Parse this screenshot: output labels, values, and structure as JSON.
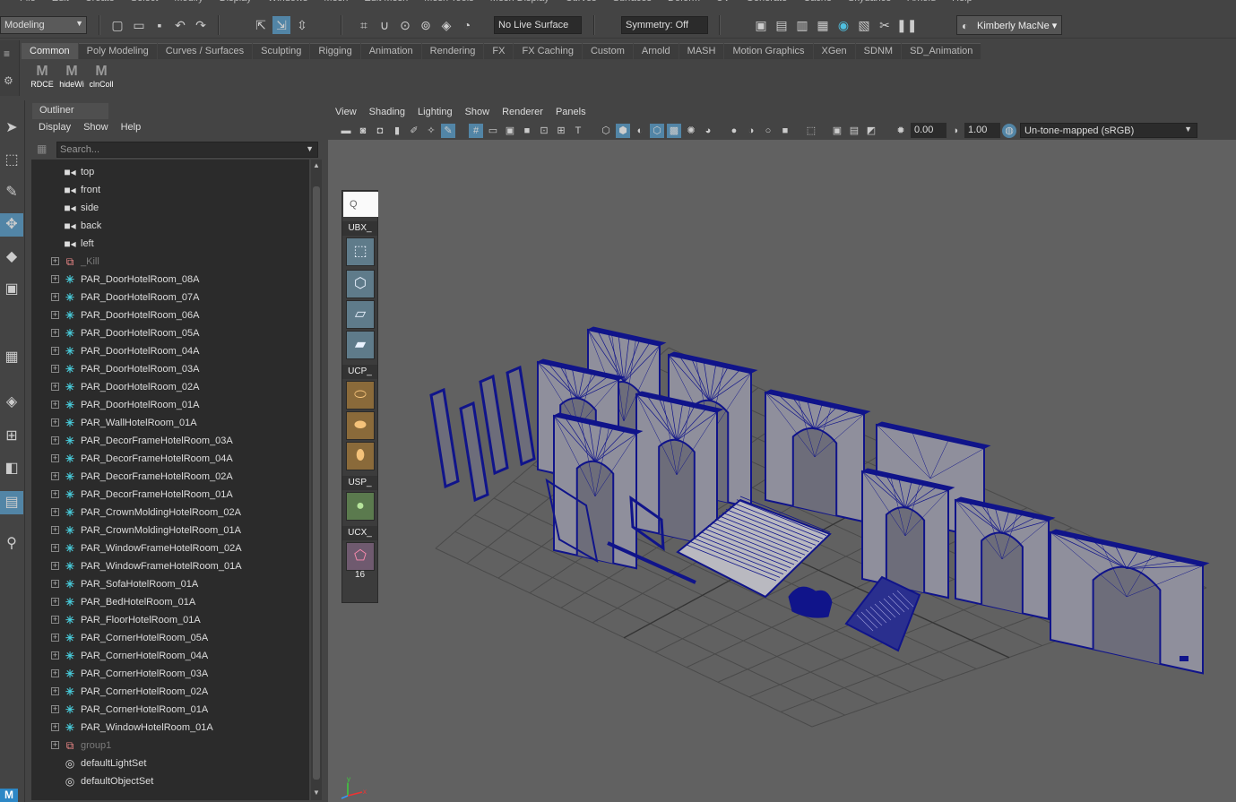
{
  "menubar": [
    "File",
    "Edit",
    "Create",
    "Select",
    "Modify",
    "Display",
    "Windows",
    "Mesh",
    "Edit Mesh",
    "Mesh Tools",
    "Mesh Display",
    "Curves",
    "Surfaces",
    "Deform",
    "UV",
    "Generate",
    "Cache",
    "Skydance",
    "Arnold",
    "Help"
  ],
  "status_line": {
    "mode": "Modeling",
    "live_surface": "No Live Surface",
    "symmetry": "Symmetry: Off",
    "user": "Kimberly MacNe"
  },
  "shelf": {
    "tabs": [
      "Common",
      "Poly Modeling",
      "Curves / Surfaces",
      "Sculpting",
      "Rigging",
      "Animation",
      "Rendering",
      "FX",
      "FX Caching",
      "Custom",
      "Arnold",
      "MASH",
      "Motion Graphics",
      "XGen",
      "SDNM",
      "SD_Animation"
    ],
    "active_tab": "Common",
    "buttons": [
      {
        "icon": "M",
        "label": "RDCE"
      },
      {
        "icon": "M",
        "label": "hideWi"
      },
      {
        "icon": "M",
        "label": "clnColl"
      }
    ]
  },
  "outliner": {
    "title": "Outliner",
    "menu": [
      "Display",
      "Show",
      "Help"
    ],
    "search_placeholder": "Search...",
    "items": [
      {
        "label": "top",
        "icon": "camera-icon",
        "type": "cam",
        "expand": false,
        "grey": false
      },
      {
        "label": "front",
        "icon": "camera-icon",
        "type": "cam",
        "expand": false,
        "grey": false
      },
      {
        "label": "side",
        "icon": "camera-icon",
        "type": "cam",
        "expand": false,
        "grey": false
      },
      {
        "label": "back",
        "icon": "camera-icon",
        "type": "cam",
        "expand": false,
        "grey": false
      },
      {
        "label": "left",
        "icon": "camera-icon",
        "type": "cam",
        "expand": false,
        "grey": false
      },
      {
        "label": "_Kill",
        "icon": "group-icon",
        "type": "grp",
        "expand": true,
        "grey": true
      },
      {
        "label": "PAR_DoorHotelRoom_08A",
        "icon": "par-icon",
        "type": "par",
        "expand": true,
        "grey": false
      },
      {
        "label": "PAR_DoorHotelRoom_07A",
        "icon": "par-icon",
        "type": "par",
        "expand": true,
        "grey": false
      },
      {
        "label": "PAR_DoorHotelRoom_06A",
        "icon": "par-icon",
        "type": "par",
        "expand": true,
        "grey": false
      },
      {
        "label": "PAR_DoorHotelRoom_05A",
        "icon": "par-icon",
        "type": "par",
        "expand": true,
        "grey": false
      },
      {
        "label": "PAR_DoorHotelRoom_04A",
        "icon": "par-icon",
        "type": "par",
        "expand": true,
        "grey": false
      },
      {
        "label": "PAR_DoorHotelRoom_03A",
        "icon": "par-icon",
        "type": "par",
        "expand": true,
        "grey": false
      },
      {
        "label": "PAR_DoorHotelRoom_02A",
        "icon": "par-icon",
        "type": "par",
        "expand": true,
        "grey": false
      },
      {
        "label": "PAR_DoorHotelRoom_01A",
        "icon": "par-icon",
        "type": "par",
        "expand": true,
        "grey": false
      },
      {
        "label": "PAR_WallHotelRoom_01A",
        "icon": "par-icon",
        "type": "par",
        "expand": true,
        "grey": false
      },
      {
        "label": "PAR_DecorFrameHotelRoom_03A",
        "icon": "par-icon",
        "type": "par",
        "expand": true,
        "grey": false
      },
      {
        "label": "PAR_DecorFrameHotelRoom_04A",
        "icon": "par-icon",
        "type": "par",
        "expand": true,
        "grey": false
      },
      {
        "label": "PAR_DecorFrameHotelRoom_02A",
        "icon": "par-icon",
        "type": "par",
        "expand": true,
        "grey": false
      },
      {
        "label": "PAR_DecorFrameHotelRoom_01A",
        "icon": "par-icon",
        "type": "par",
        "expand": true,
        "grey": false
      },
      {
        "label": "PAR_CrownMoldingHotelRoom_02A",
        "icon": "par-icon",
        "type": "par",
        "expand": true,
        "grey": false
      },
      {
        "label": "PAR_CrownMoldingHotelRoom_01A",
        "icon": "par-icon",
        "type": "par",
        "expand": true,
        "grey": false
      },
      {
        "label": "PAR_WindowFrameHotelRoom_02A",
        "icon": "par-icon",
        "type": "par",
        "expand": true,
        "grey": false
      },
      {
        "label": "PAR_WindowFrameHotelRoom_01A",
        "icon": "par-icon",
        "type": "par",
        "expand": true,
        "grey": false
      },
      {
        "label": "PAR_SofaHotelRoom_01A",
        "icon": "par-icon",
        "type": "par",
        "expand": true,
        "grey": false
      },
      {
        "label": "PAR_BedHotelRoom_01A",
        "icon": "par-icon",
        "type": "par",
        "expand": true,
        "grey": false
      },
      {
        "label": "PAR_FloorHotelRoom_01A",
        "icon": "par-icon",
        "type": "par",
        "expand": true,
        "grey": false
      },
      {
        "label": "PAR_CornerHotelRoom_05A",
        "icon": "par-icon",
        "type": "par",
        "expand": true,
        "grey": false
      },
      {
        "label": "PAR_CornerHotelRoom_04A",
        "icon": "par-icon",
        "type": "par",
        "expand": true,
        "grey": false
      },
      {
        "label": "PAR_CornerHotelRoom_03A",
        "icon": "par-icon",
        "type": "par",
        "expand": true,
        "grey": false
      },
      {
        "label": "PAR_CornerHotelRoom_02A",
        "icon": "par-icon",
        "type": "par",
        "expand": true,
        "grey": false
      },
      {
        "label": "PAR_CornerHotelRoom_01A",
        "icon": "par-icon",
        "type": "par",
        "expand": true,
        "grey": false
      },
      {
        "label": "PAR_WindowHotelRoom_01A",
        "icon": "par-icon",
        "type": "par",
        "expand": true,
        "grey": false
      },
      {
        "label": "group1",
        "icon": "group-icon",
        "type": "grp",
        "expand": true,
        "grey": true
      },
      {
        "label": "defaultLightSet",
        "icon": "set-icon",
        "type": "set",
        "expand": false,
        "grey": false
      },
      {
        "label": "defaultObjectSet",
        "icon": "set-icon",
        "type": "set",
        "expand": false,
        "grey": false
      }
    ]
  },
  "viewport": {
    "menu": [
      "View",
      "Shading",
      "Lighting",
      "Show",
      "Renderer",
      "Panels"
    ],
    "exposure": "0.00",
    "gamma": "1.00",
    "color_space": "Un-tone-mapped (sRGB)",
    "wire_color": "#10148a",
    "face_color": "#8f8f9c",
    "grid_color": "#4a4a4a",
    "background_color": "#616161"
  },
  "uv_tool": {
    "search": "Q",
    "sections": [
      "UBX_",
      "UCP_",
      "USP_",
      "UCX_"
    ],
    "count": "16"
  }
}
